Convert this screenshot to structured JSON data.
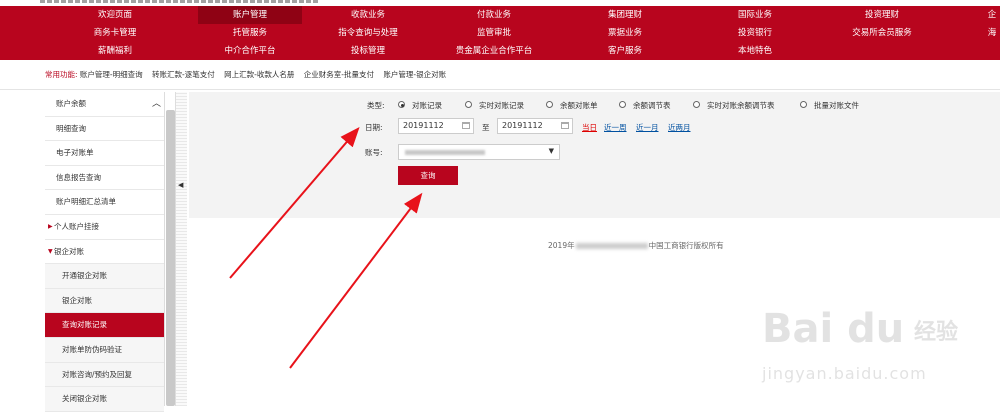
{
  "nav": {
    "row1": [
      "欢迎页面",
      "账户管理",
      "收款业务",
      "付款业务",
      "集团理财",
      "国际业务",
      "投资理财",
      "企"
    ],
    "row2": [
      "商务卡管理",
      "托管服务",
      "指令查询与处理",
      "监管审批",
      "票据业务",
      "投资银行",
      "交易所会员服务",
      "海"
    ],
    "row3": [
      "薪酬福利",
      "中介合作平台",
      "投标管理",
      "贵金属企业合作平台",
      "客户服务",
      "本地特色"
    ],
    "active": "账户管理"
  },
  "quick": {
    "label": "常用功能:",
    "links": [
      "账户管理-明细查询",
      "转账汇款-逐笔支付",
      "网上汇款-收款人名册",
      "企业财务室-批量支付",
      "账户管理-银企对账"
    ]
  },
  "sidebar": {
    "items": [
      {
        "label": "账户余额",
        "type": "top"
      },
      {
        "label": "明细查询",
        "type": "top"
      },
      {
        "label": "电子对账单",
        "type": "top"
      },
      {
        "label": "信息报告查询",
        "type": "top"
      },
      {
        "label": "账户明细汇总清单",
        "type": "top"
      },
      {
        "label": "个人账户挂接",
        "type": "group"
      },
      {
        "label": "银企对账",
        "type": "group-open"
      },
      {
        "label": "开通银企对账",
        "type": "sub"
      },
      {
        "label": "银企对账",
        "type": "sub"
      },
      {
        "label": "查询对账记录",
        "type": "sub-active"
      },
      {
        "label": "对账单防伪码验证",
        "type": "sub"
      },
      {
        "label": "对账咨询/预约及回复",
        "type": "sub"
      },
      {
        "label": "关闭银企对账",
        "type": "sub"
      }
    ]
  },
  "form": {
    "type_label": "类型:",
    "types": [
      "对账记录",
      "实时对账记录",
      "余额对账单",
      "余额调节表",
      "实时对账余额调节表",
      "批量对账文件"
    ],
    "selected_type": "对账记录",
    "date_label": "日期:",
    "date_from": "20191112",
    "date_sep": "至",
    "date_to": "20191112",
    "quick_dates": [
      "当日",
      "近一周",
      "近一月",
      "近两月"
    ],
    "account_label": "账号:",
    "query_button": "查询"
  },
  "footer": {
    "prefix": "2019年",
    "suffix": "中国工商银行版权所有"
  },
  "watermark": {
    "brand": "Bai du",
    "cn": "经验",
    "url": "jingyan.baidu.com"
  },
  "colors": {
    "brand": "#b8051e",
    "arrow": "#e8121a"
  }
}
